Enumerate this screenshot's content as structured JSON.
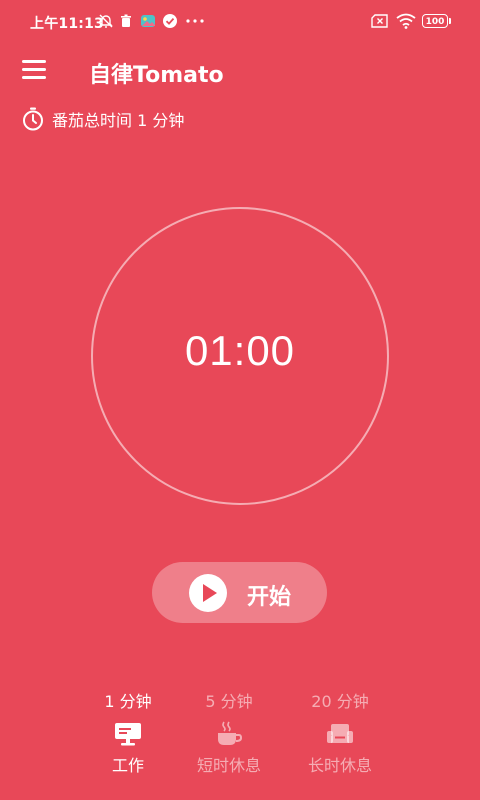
{
  "status_bar": {
    "time": "上午11:13",
    "battery": "100",
    "icons": [
      "mute-bell-icon",
      "trash-icon",
      "gallery-icon",
      "check-circle-icon",
      "more-icon",
      "sim-error-icon",
      "wifi-icon"
    ]
  },
  "app_bar": {
    "title": "自律Tomato",
    "menu_icon": "menu-icon"
  },
  "summary": {
    "total_time": "番茄总时间 1 分钟",
    "icon": "stopwatch-icon"
  },
  "timer": {
    "display": "01:00"
  },
  "start_button": {
    "label": "开始",
    "icon": "play-icon"
  },
  "modes": [
    {
      "duration": "1 分钟",
      "label": "工作",
      "icon": "monitor-icon",
      "selected": true
    },
    {
      "duration": "5 分钟",
      "label": "短时休息",
      "icon": "coffee-cup-icon",
      "selected": false
    },
    {
      "duration": "20 分钟",
      "label": "长时休息",
      "icon": "sofa-icon",
      "selected": false
    }
  ],
  "colors": {
    "background": "#e84858",
    "foreground": "#ffffff"
  }
}
